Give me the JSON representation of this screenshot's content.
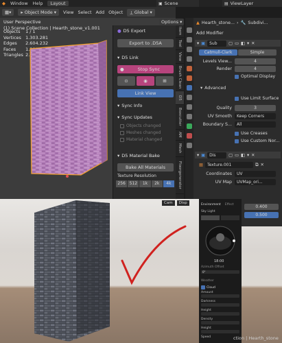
{
  "topbar": {
    "menus": [
      "Window",
      "Help",
      "Layout"
    ],
    "active_tab": "Layout",
    "scene": "Scene",
    "view_layer": "ViewLayer"
  },
  "viewport_header": {
    "mode": "Object Mode",
    "menus": [
      "View",
      "Select",
      "Add",
      "Object"
    ],
    "orientation": "Global",
    "options": "Options"
  },
  "viewport_overlay": {
    "perspective": "User Perspective",
    "collection": "(1) Scene Collection | Hearth_stone_v1.001",
    "stats": [
      {
        "label": "Objects",
        "value": "1 / 1"
      },
      {
        "label": "Vertices",
        "value": "1.303.281"
      },
      {
        "label": "Edges",
        "value": "2.604.232"
      },
      {
        "label": "Faces",
        "value": "1.300.962"
      },
      {
        "label": "Triangles",
        "value": "2.601.924"
      }
    ]
  },
  "d5_panel": {
    "export_title": "D5 Export",
    "export_btn": "Export to .D5A",
    "link_title": "D5 Link",
    "stop_sync": "Stop Sync",
    "link_view": "Link View",
    "sync_info": "Sync Info",
    "sync_updates": "Sync Updates",
    "sync_items": [
      "Objects changed",
      "Meshes changed",
      "Material changed"
    ],
    "material_bake": "D5 Material Bake",
    "bake_all": "Bake All Materials",
    "texture_resolution": "Texture Resolution",
    "resolutions": [
      "256",
      "512",
      "1k",
      "2k",
      "4k"
    ],
    "active_resolution": "4k"
  },
  "vertical_tabs": [
    "Item",
    "Tool",
    "View",
    "Brush Clean",
    "D5",
    "Boxcutter",
    "AM",
    "Mesh",
    "Floorgenerator"
  ],
  "properties": {
    "breadcrumb_object": "Hearth_stone...",
    "breadcrumb_mod": "Subdivi...",
    "add_modifier": "Add Modifier",
    "subsurf_name": "Sub",
    "catmull": "Catmull-Clark",
    "simple": "Simple",
    "levels_viewport_label": "Levels View...",
    "levels_viewport": "4",
    "render_label": "Render",
    "render": "4",
    "optimal_display": "Optimal Display",
    "advanced": "Advanced",
    "use_limit_surface": "Use Limit Surface",
    "quality_label": "Quality",
    "quality": "3",
    "uv_smooth_label": "UV Smooth",
    "uv_smooth": "Keep Corners",
    "boundary_label": "Boundary S...",
    "boundary": "All",
    "use_creases": "Use Creases",
    "use_custom_normals": "Use Custom Nor...",
    "dis_name": "Dis",
    "texture": "Texture.001",
    "coordinates_label": "Coordinates",
    "coordinates": "UV",
    "uvmap_label": "UV Map",
    "uvmap": "UVMap_ori..."
  },
  "render_view": {
    "top_tabs": [
      "Cam",
      "Disp"
    ],
    "panel_tabs": [
      "Environment",
      "Effect"
    ],
    "sky_label": "Sky Light",
    "time": "18:00",
    "azimuth_label": "Azimuth Offset",
    "azimuth_value": "0°",
    "values": [
      "0.400",
      "0.500"
    ],
    "weather_label": "Weather",
    "cloud_label": "Cloud",
    "rows": [
      "Amount",
      "Darkness",
      "Height",
      "Density",
      "Height",
      "Speed"
    ],
    "caption": "ction | Hearth_stone"
  }
}
